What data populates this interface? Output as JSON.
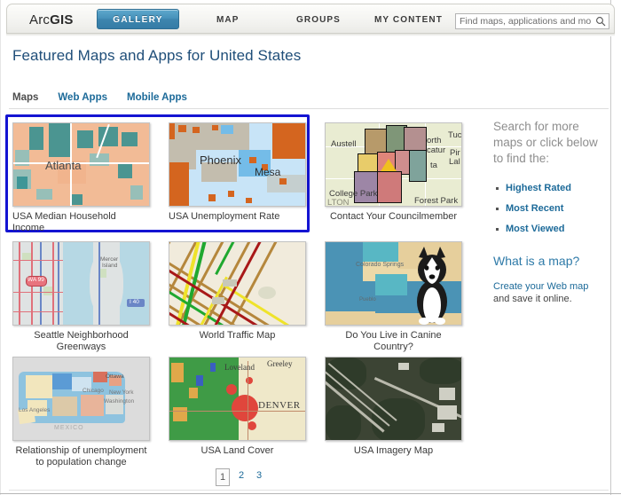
{
  "header": {
    "brand_prefix": "Arc",
    "brand_suffix": "GIS",
    "gallery_label": "GALLERY",
    "nav": [
      {
        "label": "MAP",
        "name": "nav-map"
      },
      {
        "label": "GROUPS",
        "name": "nav-groups"
      },
      {
        "label": "MY CONTENT",
        "name": "nav-my-content"
      }
    ],
    "search": {
      "placeholder": "Find maps, applications and more...",
      "value": "",
      "icon": "search-icon"
    },
    "accent_color": "#3d85ae"
  },
  "page": {
    "title": "Featured Maps and Apps for United States",
    "title_color": "#1f4e79",
    "highlight_color": "#1414d2"
  },
  "tabs": [
    {
      "label": "Maps",
      "active": true
    },
    {
      "label": "Web Apps",
      "active": false
    },
    {
      "label": "Mobile Apps",
      "active": false
    }
  ],
  "gallery": {
    "items": [
      {
        "title": "USA Median Household Income",
        "thumb_label": "Atlanta",
        "highlighted": true
      },
      {
        "title": "USA Unemployment Rate",
        "thumb_label": "Phoenix",
        "thumb_label2": "Mesa",
        "highlighted": true
      },
      {
        "title": "Contact Your Councilmember",
        "thumb_label": "Austell",
        "thumb_label2": "College Park",
        "thumb_label3": "Forest Park",
        "thumb_label4": "LTON",
        "thumb_label5": "Tuc",
        "highlighted": false
      },
      {
        "title": "Seattle Neighborhood Greenways",
        "thumb_label": "Mercer Island",
        "thumb_label2": "WA 99",
        "thumb_label3": "I 40",
        "highlighted": false
      },
      {
        "title": "World Traffic Map",
        "thumb_label": "",
        "highlighted": false
      },
      {
        "title": "Do You Live in Canine Country?",
        "thumb_label": "Colorado Springs",
        "highlighted": false
      },
      {
        "title": "Relationship of unemployment to population change",
        "thumb_label": "Ottawa",
        "thumb_label2": "MEXICO",
        "highlighted": false
      },
      {
        "title": "USA Land Cover",
        "thumb_label": "Loveland",
        "thumb_label2": "Greeley",
        "thumb_label3": "DENVER",
        "highlighted": false
      },
      {
        "title": "USA Imagery Map",
        "thumb_label": "",
        "highlighted": false
      }
    ]
  },
  "sidebar": {
    "heading": "Search for more maps or click below to find the:",
    "links": [
      {
        "label": "Highest Rated"
      },
      {
        "label": "Most Recent"
      },
      {
        "label": "Most Viewed"
      }
    ],
    "subheading": "What is a map?",
    "body_link": "Create your Web map",
    "body_rest": " and save it online."
  },
  "pagination": {
    "pages": [
      {
        "label": "1",
        "current": true
      },
      {
        "label": "2",
        "current": false
      },
      {
        "label": "3",
        "current": false
      }
    ]
  }
}
